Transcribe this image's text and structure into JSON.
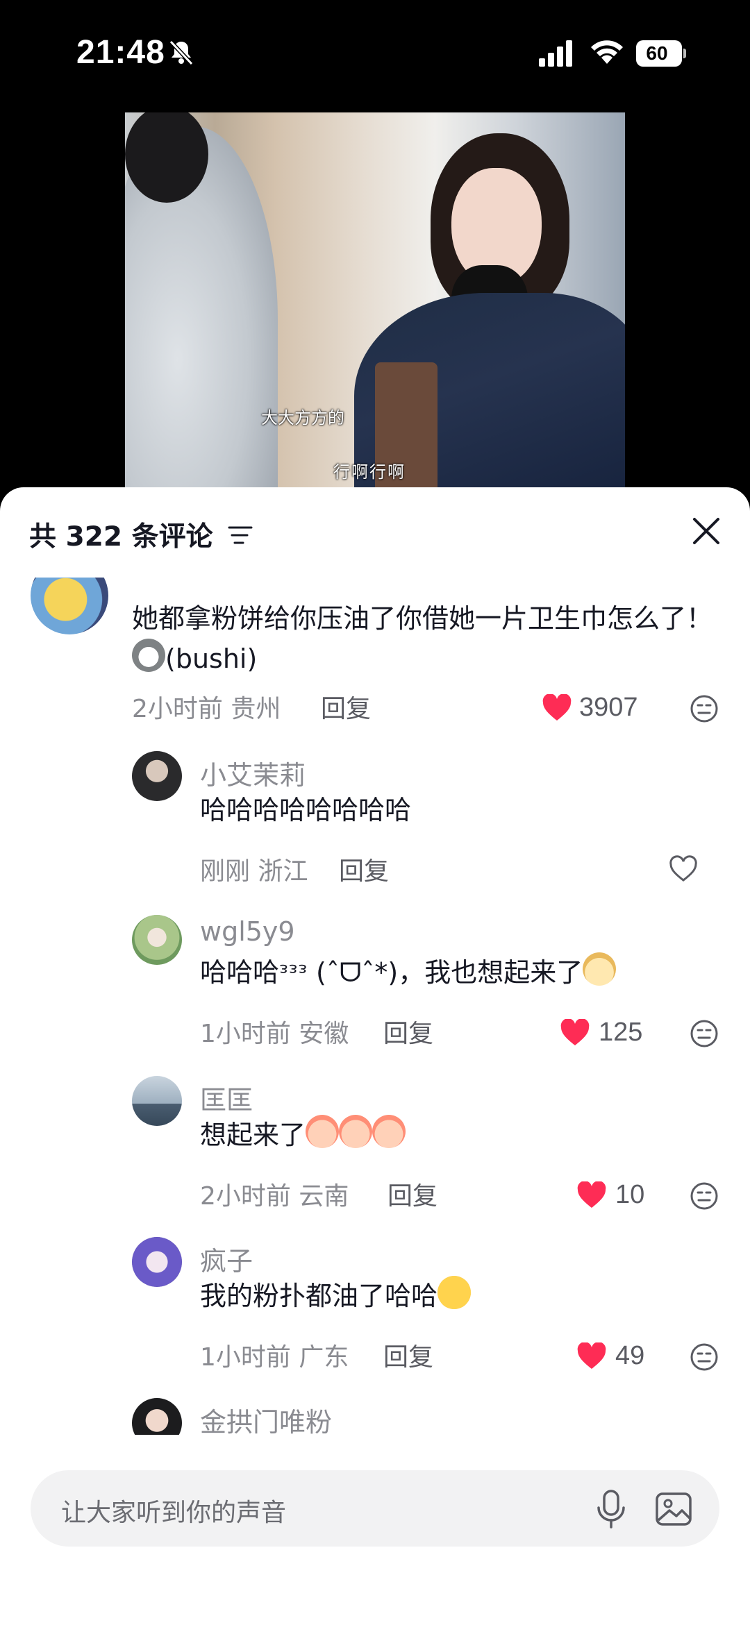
{
  "status_bar": {
    "time": "21:48",
    "battery": "60"
  },
  "video": {
    "subtitle_1": "大大方方的",
    "subtitle_2": "行啊行啊"
  },
  "sheet": {
    "title": "共 322 条评论"
  },
  "comments": [
    {
      "text": "她都拿粉饼给你压油了你借她一片卫生巾怎么了！",
      "text_suffix": "(bushi)",
      "time_location": "2小时前 贵州",
      "reply": "回复",
      "likes": "3907",
      "liked": true
    },
    {
      "name": "小艾茉莉",
      "text": "哈哈哈哈哈哈哈哈",
      "time_location": "刚刚 浙江",
      "reply": "回复",
      "liked": false
    },
    {
      "name": "wgl5y9",
      "text": "哈哈哈ᵌᵌᵌ (ˆᗜˆ*)，我也想起来了",
      "time_location": "1小时前 安徽",
      "reply": "回复",
      "likes": "125",
      "liked": true
    },
    {
      "name": "匡匡",
      "text": "想起来了",
      "time_location": "2小时前 云南",
      "reply": "回复",
      "likes": "10",
      "liked": true
    },
    {
      "name": "疯子",
      "text": "我的粉扑都油了哈哈",
      "time_location": "1小时前 广东",
      "reply": "回复",
      "likes": "49",
      "liked": true
    },
    {
      "name": "金拱门唯粉"
    }
  ],
  "input": {
    "placeholder": "让大家听到你的声音"
  },
  "colors": {
    "like": "#fe2c55",
    "text": "#161823",
    "muted": "#8a8b91"
  }
}
